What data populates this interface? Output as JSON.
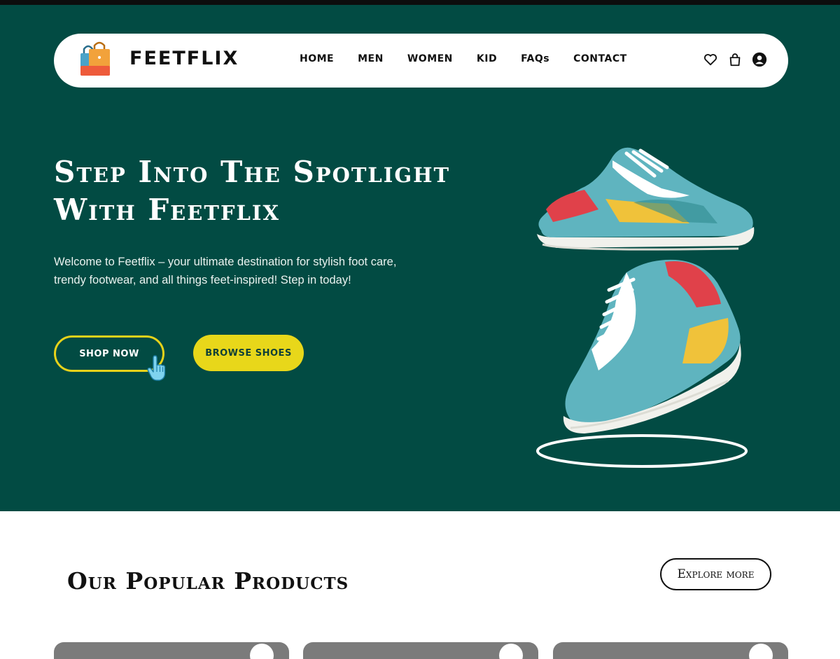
{
  "brand": {
    "name": "FEETFLIX",
    "logo_icon": "shopping-bags-icon",
    "colors": {
      "hero_bg": "#024b43",
      "accent_yellow": "#e8d71a",
      "text_dark": "#111111"
    }
  },
  "nav": {
    "links": [
      "HOME",
      "MEN",
      "WOMEN",
      "KID",
      "FAQs",
      "CONTACT"
    ],
    "icons": [
      "heart-icon",
      "bag-icon",
      "user-icon"
    ]
  },
  "hero": {
    "headline_line1": "Step Into The Spotlight",
    "headline_line2": "With Feetflix",
    "intro_line1": "Welcome to Feetflix – your ultimate destination for stylish foot care,",
    "intro_line2": "trendy footwear, and all things feet-inspired! Step in today!",
    "shop_button": "SHOP NOW",
    "browse_button": "BROWSE SHOES"
  },
  "popular": {
    "title": "Our Popular Products",
    "explore_button": "Explore more",
    "cards": [
      {},
      {},
      {}
    ]
  }
}
